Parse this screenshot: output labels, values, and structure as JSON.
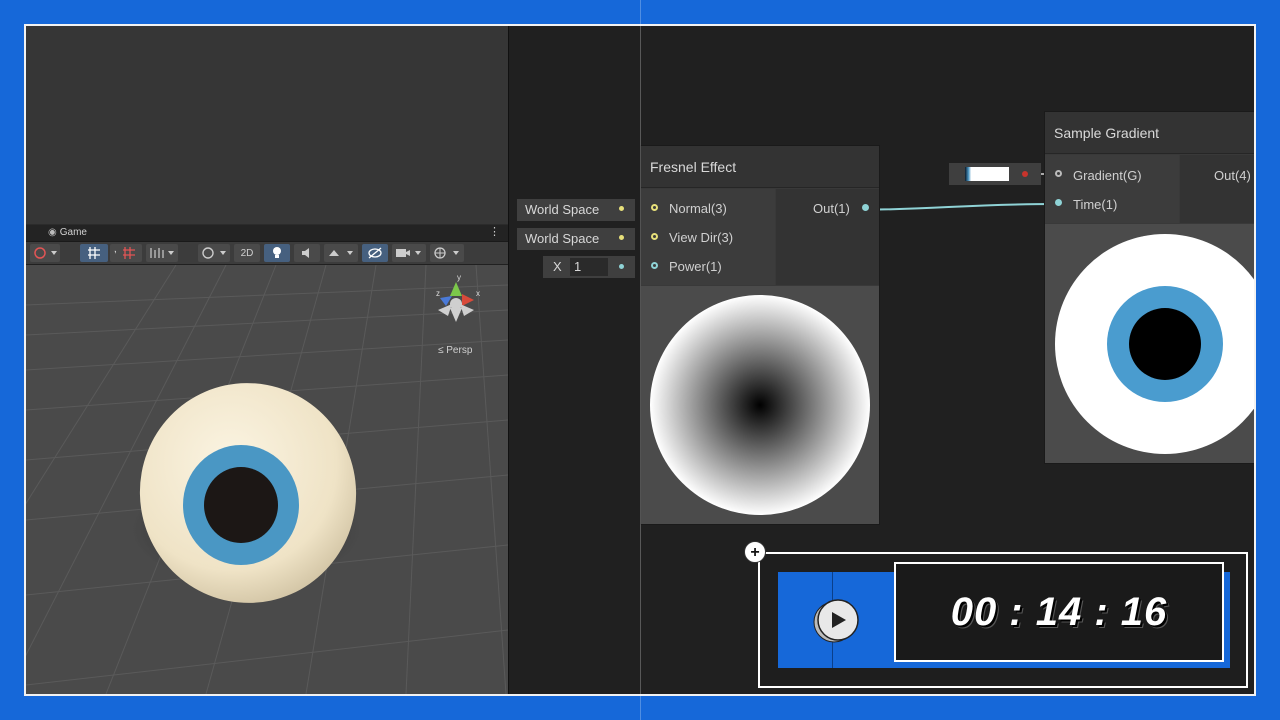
{
  "scene": {
    "tab_label": "Game",
    "tab_menu": "⋮",
    "toolbar": {
      "mode_2d": "2D"
    },
    "persp_label": "≤ Persp",
    "gizmo_axes": {
      "x": "x",
      "y": "y",
      "z": "z"
    }
  },
  "graph": {
    "fresnel": {
      "title": "Fresnel Effect",
      "inputs": [
        "Normal(3)",
        "View Dir(3)",
        "Power(1)"
      ],
      "output": "Out(1)"
    },
    "input_props": {
      "normal_value": "World Space",
      "viewdir_value": "World Space",
      "power_prefix": "X",
      "power_value": "1"
    },
    "sample_gradient": {
      "title": "Sample Gradient",
      "inputs": [
        "Gradient(G)",
        "Time(1)"
      ],
      "output": "Out(4)"
    }
  },
  "timer": {
    "time": "00 : 14 : 16",
    "plus": "+"
  },
  "colors": {
    "brand_blue": "#1668d9",
    "port_yellow": "#e7e07a",
    "port_cyan": "#8fd3d6",
    "iris_blue": "#4a9ccf"
  }
}
